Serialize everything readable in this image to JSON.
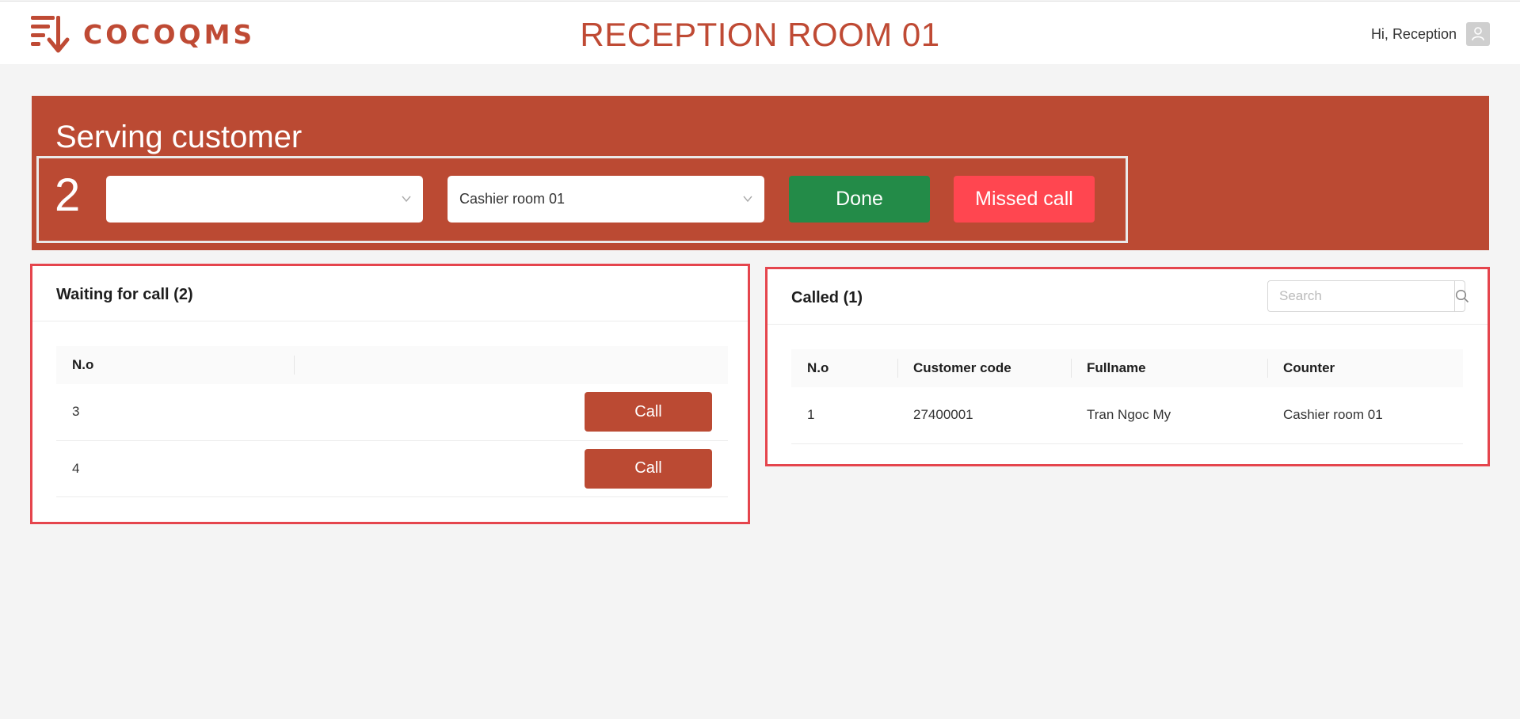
{
  "header": {
    "logo_text": "COCOQMS",
    "title": "RECEPTION ROOM 01",
    "greeting": "Hi, Reception"
  },
  "serving": {
    "title": "Serving customer",
    "number": "2",
    "select_1_value": "",
    "select_2_value": "Cashier room 01",
    "done_label": "Done",
    "missed_label": "Missed call"
  },
  "waiting": {
    "title": "Waiting for call (2)",
    "columns": [
      "N.o",
      ""
    ],
    "rows": [
      {
        "no": "3",
        "action": "Call"
      },
      {
        "no": "4",
        "action": "Call"
      }
    ]
  },
  "called": {
    "title": "Called (1)",
    "search_placeholder": "Search",
    "columns": [
      "N.o",
      "Customer code",
      "Fullname",
      "Counter"
    ],
    "rows": [
      {
        "no": "1",
        "code": "27400001",
        "fullname": "Tran Ngoc My",
        "counter": "Cashier room 01"
      }
    ]
  },
  "colors": {
    "brand": "#bb4a33",
    "done": "#238b48",
    "missed": "#ff4650",
    "highlight_border": "#e5454d"
  }
}
